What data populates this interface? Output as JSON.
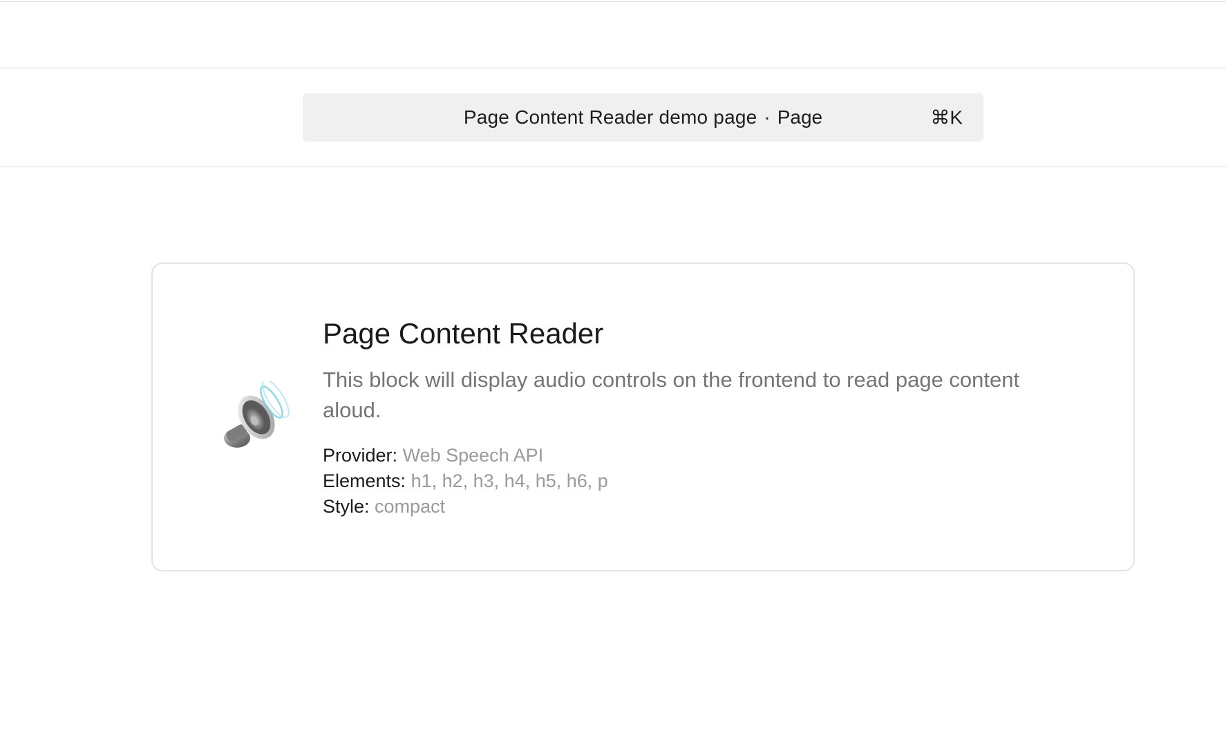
{
  "command_bar": {
    "title": "Page Content Reader demo page",
    "separator": "·",
    "type": "Page",
    "shortcut": "⌘K"
  },
  "block": {
    "icon": "speaker-icon",
    "title": "Page Content Reader",
    "description": "This block will display audio controls on the frontend to read page content aloud.",
    "meta": [
      {
        "label": "Provider:",
        "value": "Web Speech API"
      },
      {
        "label": "Elements:",
        "value": "h1, h2, h3, h4, h5, h6, p"
      },
      {
        "label": "Style:",
        "value": "compact"
      }
    ]
  },
  "colors": {
    "command_bar_bg": "#f0f0f0",
    "border": "#e4e4e4",
    "muted_text": "#757575",
    "value_text": "#9a9a9a",
    "speaker_wave": "#7fd3e6"
  }
}
